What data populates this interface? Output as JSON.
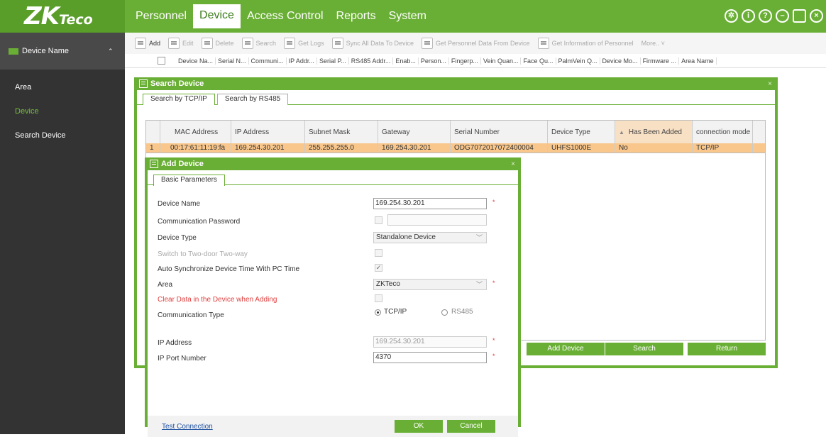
{
  "logo": {
    "main": "ZK",
    "sub": "Teco"
  },
  "menu": [
    "Personnel",
    "Device",
    "Access Control",
    "Reports",
    "System"
  ],
  "top_icons": [
    "gear-icon",
    "info-icon",
    "help-icon",
    "minimize-icon",
    "maximize-icon",
    "close-icon"
  ],
  "sidebar": {
    "header": "Device Name",
    "items": [
      "Area",
      "Device",
      "Search Device"
    ]
  },
  "toolbar": [
    "Add",
    "Edit",
    "Delete",
    "Search",
    "Get Logs",
    "Sync All Data To Device",
    "Get Personnel Data From Device",
    "Get Information of Personnel",
    "More.."
  ],
  "columns": [
    "Device Na...",
    "Serial N...",
    "Communi...",
    "IP Addr...",
    "Serial P...",
    "RS485 Addr...",
    "Enab...",
    "Person...",
    "Fingerp...",
    "Vein Quan...",
    "Face Qu...",
    "PalmVein Q...",
    "Device Mo...",
    "Firmware ...",
    "Area Name"
  ],
  "search_window": {
    "title": "Search Device",
    "tabs": [
      "Search by TCP/IP",
      "Search by RS485"
    ],
    "headers": [
      "MAC Address",
      "IP Address",
      "Subnet Mask",
      "Gateway",
      "Serial Number",
      "Device Type",
      "Has Been Added",
      "connection mode"
    ],
    "row": {
      "index": "1",
      "mac": "00:17:61:11:19:fa",
      "ip": "169.254.30.201",
      "mask": "255.255.255.0",
      "gateway": "169.254.30.201",
      "serial": "ODG7072017072400004",
      "type": "UHFS1000E",
      "added": "No",
      "mode": "TCP/IP"
    },
    "buttons": [
      "Add Device",
      "Search",
      "Return"
    ]
  },
  "add_window": {
    "title": "Add Device",
    "tab": "Basic Parameters",
    "fields": {
      "device_name_label": "Device Name",
      "device_name_value": "169.254.30.201",
      "comm_password_label": "Communication Password",
      "device_type_label": "Device Type",
      "device_type_value": "Standalone Device",
      "switch_label": "Switch to Two-door Two-way",
      "auto_sync_label": "Auto Synchronize Device Time With PC Time",
      "area_label": "Area",
      "area_value": "ZKTeco",
      "clear_label": "Clear Data in the Device when Adding",
      "comm_type_label": "Communication Type",
      "comm_type_tcp": "TCP/IP",
      "comm_type_rs485": "RS485",
      "ip_label": "IP Address",
      "ip_value": "169.254.30.201",
      "port_label": "IP Port Number",
      "port_value": "4370"
    },
    "test_link": "Test Connection",
    "ok": "OK",
    "cancel": "Cancel"
  },
  "colors": {
    "accent": "#6aaf35",
    "selected_row": "#f9c78c",
    "required": "#e13d3d"
  }
}
